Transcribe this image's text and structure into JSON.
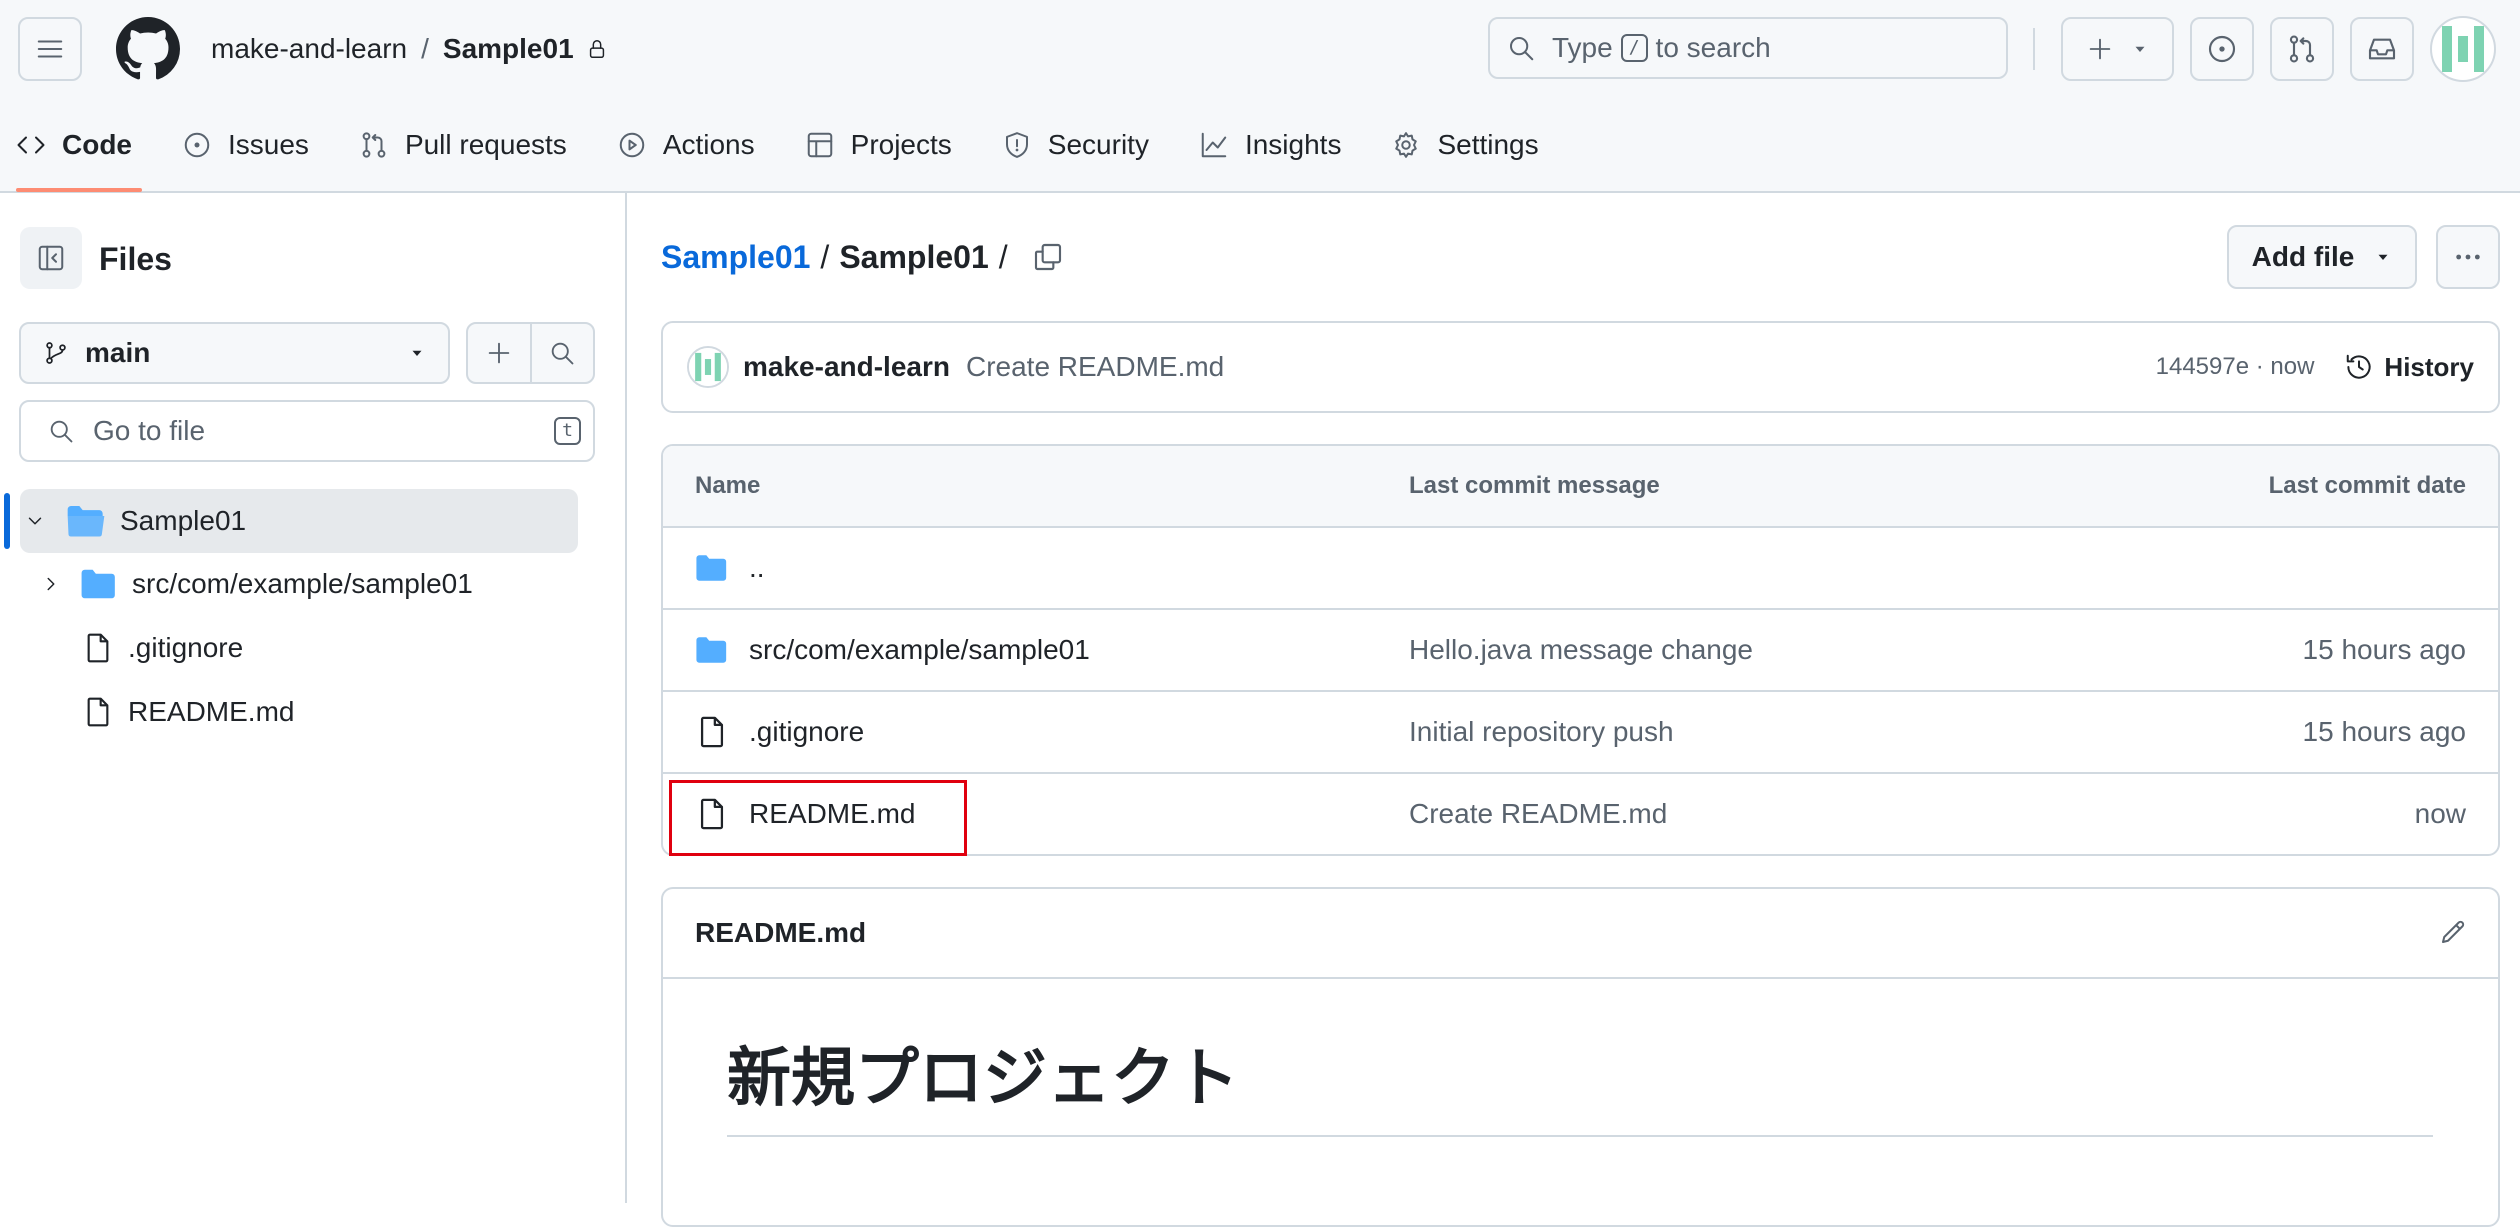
{
  "header": {
    "owner": "make-and-learn",
    "separator": "/",
    "repo": "Sample01",
    "search": {
      "prefix": "Type",
      "key": "/",
      "suffix": "to search"
    },
    "create_label": "+"
  },
  "tabs": [
    {
      "label": "Code",
      "icon": "code-icon"
    },
    {
      "label": "Issues",
      "icon": "issue-opened-icon"
    },
    {
      "label": "Pull requests",
      "icon": "git-pull-request-icon"
    },
    {
      "label": "Actions",
      "icon": "play-icon"
    },
    {
      "label": "Projects",
      "icon": "table-icon"
    },
    {
      "label": "Security",
      "icon": "shield-icon"
    },
    {
      "label": "Insights",
      "icon": "graph-icon"
    },
    {
      "label": "Settings",
      "icon": "gear-icon"
    }
  ],
  "sidebar": {
    "title": "Files",
    "branch": "main",
    "goto_placeholder": "Go to file",
    "goto_key": "t",
    "tree": [
      {
        "label": "Sample01",
        "type": "folder-open",
        "selected": true
      },
      {
        "label": "src/com/example/sample01",
        "type": "folder"
      },
      {
        "label": ".gitignore",
        "type": "file"
      },
      {
        "label": "README.md",
        "type": "file"
      }
    ]
  },
  "breadcrumb": {
    "root": "Sample01",
    "sep": "/",
    "current": "Sample01",
    "trail": "/"
  },
  "toolbar": {
    "add_file": "Add file"
  },
  "commit": {
    "author": "make-and-learn",
    "message": "Create README.md",
    "meta": "144597e · now",
    "history": "History"
  },
  "table": {
    "headers": {
      "name": "Name",
      "message": "Last commit message",
      "date": "Last commit date"
    },
    "rows": [
      {
        "name": "..",
        "type": "folder",
        "message": "",
        "date": ""
      },
      {
        "name": "src/com/example/sample01",
        "type": "folder",
        "message": "Hello.java message change",
        "date": "15 hours ago"
      },
      {
        "name": ".gitignore",
        "type": "file",
        "message": "Initial repository push",
        "date": "15 hours ago"
      },
      {
        "name": "README.md",
        "type": "file",
        "message": "Create README.md",
        "date": "now"
      }
    ]
  },
  "readme": {
    "filename": "README.md",
    "heading": "新規プロジェクト"
  },
  "colors": {
    "accent": "#0969da",
    "tab_underline": "#fd8c73",
    "folder": "#54aeff",
    "highlight": "#e0000f"
  }
}
